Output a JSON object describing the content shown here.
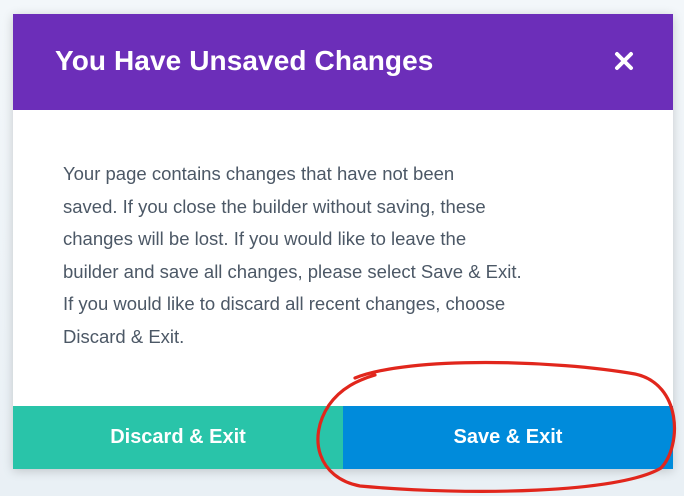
{
  "modal": {
    "title": "You Have Unsaved Changes",
    "close_icon": "close-icon",
    "body_lines": [
      "Your page contains changes that have not been",
      "saved. If you close the builder without saving, these",
      "changes will be lost. If you would like to leave the",
      "builder and save all changes, please select Save & Exit.",
      "If you would like to discard all recent changes, choose",
      "Discard & Exit."
    ],
    "discard_label": "Discard & Exit",
    "save_label": "Save & Exit"
  },
  "colors": {
    "header": "#6c2eb9",
    "discard": "#29c4a9",
    "save": "#008bdb",
    "annotation": "#e1261c"
  }
}
